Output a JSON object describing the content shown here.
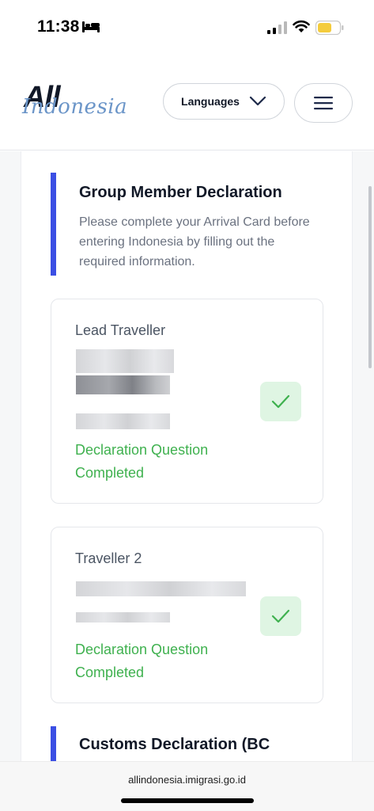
{
  "status_bar": {
    "time": "11:38"
  },
  "header": {
    "logo_main": "All",
    "logo_sub": "Indonesia",
    "languages_label": "Languages"
  },
  "section": {
    "title": "Group Member Declaration",
    "description": "Please complete your Arrival Card before entering Indonesia by filling out the required information."
  },
  "travellers": [
    {
      "title": "Lead Traveller",
      "status": "Declaration Question Completed"
    },
    {
      "title": "Traveller 2",
      "status": "Declaration Question Completed"
    }
  ],
  "customs": {
    "title": "Customs Declaration (BC"
  },
  "browser": {
    "url": "allindonesia.imigrasi.go.id"
  },
  "colors": {
    "accent": "#3b4fe4",
    "success": "#3fb14f",
    "success_bg": "#dff5e3",
    "logo_blue": "#6b95c8"
  },
  "icons": [
    "bed-icon",
    "signal-icon",
    "wifi-icon",
    "battery-icon",
    "chevron-down-icon",
    "menu-icon",
    "check-icon"
  ]
}
